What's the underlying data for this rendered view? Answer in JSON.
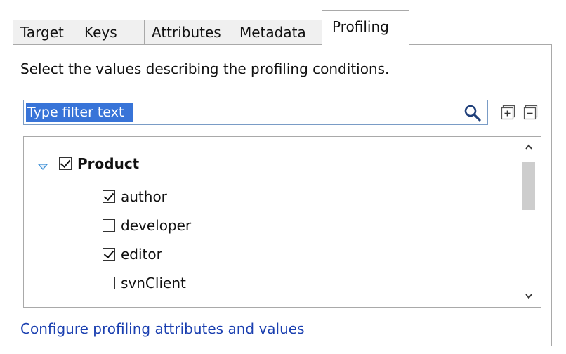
{
  "tabs": [
    {
      "label": "Target",
      "active": false
    },
    {
      "label": "Keys",
      "active": false
    },
    {
      "label": "Attributes",
      "active": false
    },
    {
      "label": "Metadata",
      "active": false
    },
    {
      "label": "Profiling",
      "active": true
    }
  ],
  "panel": {
    "instructions": "Select the values describing the profiling conditions.",
    "filter": {
      "value": "Type filter text",
      "selected": true,
      "search_icon": "search-icon"
    },
    "toolbar": {
      "expand_icon": "expand-all-icon",
      "collapse_icon": "collapse-all-icon"
    },
    "tree": {
      "group": {
        "label": "Product",
        "checked": true,
        "expanded": true
      },
      "items": [
        {
          "label": "author",
          "checked": true
        },
        {
          "label": "developer",
          "checked": false
        },
        {
          "label": "editor",
          "checked": true
        },
        {
          "label": "svnClient",
          "checked": false
        }
      ]
    },
    "link": "Configure profiling attributes and values"
  },
  "colors": {
    "selection": "#3874d8",
    "link": "#1a3fb0",
    "border": "#a9a9a9",
    "twisty": "#3c8fd6"
  }
}
